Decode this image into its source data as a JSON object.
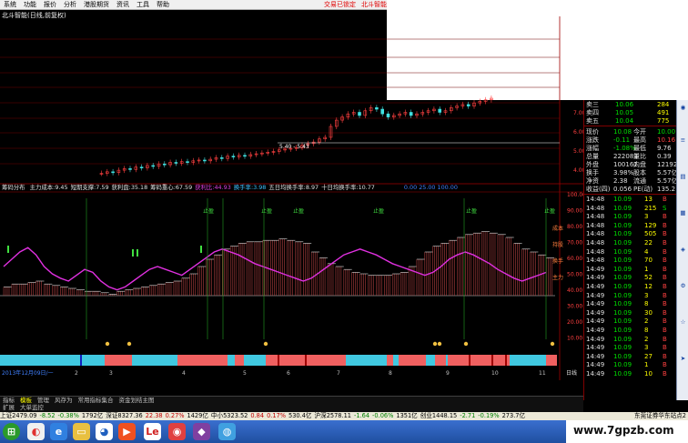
{
  "menu": [
    "系统",
    "功能",
    "报价",
    "分析",
    "港股期货",
    "资讯",
    "工具",
    "帮助"
  ],
  "trade_links": [
    "交易已锁定",
    "北斗智能"
  ],
  "chart_title": "北斗智能(日线,前复权)",
  "price_axis": [
    "7.00",
    "6.00",
    "5.00",
    "4.00"
  ],
  "range_label": "5.40 - 5.43",
  "indicator": {
    "name": "筹码分布",
    "items": [
      {
        "label": "主力成本:",
        "value": "9.45",
        "color": "#e0e0e0"
      },
      {
        "label": "短期支撑:",
        "value": "7.59",
        "color": "#e0e0e0"
      },
      {
        "label": "获利盘:",
        "value": "35.18",
        "color": "#e0e0e0"
      },
      {
        "label": "筹码重心:",
        "value": "67.59",
        "color": "#e0e0e0"
      },
      {
        "label": "获利比:",
        "value": "44.93",
        "color": "#e040e0"
      },
      {
        "label": "换手率:",
        "value": "3.98",
        "color": "#40c0ff"
      },
      {
        "label": "五日均换手率:",
        "value": "8.97",
        "color": "#e0e0e0"
      },
      {
        "label": "十日均换手率:",
        "value": "10.77",
        "color": "#e0e0e0"
      }
    ],
    "range": [
      "0.00",
      "25.00",
      "100.00"
    ]
  },
  "ind_axis": [
    "100.00",
    "90.00",
    "80.00",
    "70.00",
    "60.00",
    "50.00",
    "40.00",
    "30.00",
    "20.00",
    "10.00"
  ],
  "ind_side": [
    "成本",
    "持股",
    "换手",
    "主力"
  ],
  "markers": [
    "止盈",
    "止盈",
    "止盈",
    "止盈",
    "止盈",
    "止盈"
  ],
  "date_axis": [
    "2013年12月09日/一",
    "2",
    "3",
    "4",
    "5",
    "6",
    "7",
    "8",
    "9",
    "10",
    "11"
  ],
  "date_end": "日线",
  "quote": {
    "asks": [
      {
        "label": "卖三",
        "price": "10.06",
        "vol": "284"
      },
      {
        "label": "卖四",
        "price": "10.05",
        "vol": "491"
      },
      {
        "label": "卖五",
        "price": "10.04",
        "vol": "775"
      }
    ],
    "stats": [
      {
        "l": "现价",
        "v": "10.08",
        "l2": "今开",
        "v2": "10.00"
      },
      {
        "l": "涨跌",
        "v": "-0.11",
        "l2": "最高",
        "v2": "10.16"
      },
      {
        "l": "涨幅",
        "v": "-1.08%",
        "l2": "最低",
        "v2": "9.76"
      },
      {
        "l": "总量",
        "v": "222083",
        "l2": "量比",
        "v2": "0.39"
      },
      {
        "l": "外盘",
        "v": "100161",
        "l2": "内盘",
        "v2": "121922"
      },
      {
        "l": "换手",
        "v": "3.98%",
        "l2": "股本",
        "v2": "5.57亿"
      },
      {
        "l": "净资",
        "v": "2.38",
        "l2": "流通",
        "v2": "5.57亿"
      },
      {
        "l": "收益(四)",
        "v": "0.056",
        "l2": "PE(动)",
        "v2": "135.2"
      }
    ],
    "ticks": [
      {
        "t": "14:48",
        "p": "10.09",
        "v": "13",
        "s": "B"
      },
      {
        "t": "14:48",
        "p": "10.09",
        "v": "215",
        "s": "S"
      },
      {
        "t": "14:48",
        "p": "10.09",
        "v": "3",
        "s": "B"
      },
      {
        "t": "14:48",
        "p": "10.09",
        "v": "129",
        "s": "B"
      },
      {
        "t": "14:48",
        "p": "10.09",
        "v": "505",
        "s": "B"
      },
      {
        "t": "14:48",
        "p": "10.09",
        "v": "22",
        "s": "B"
      },
      {
        "t": "14:48",
        "p": "10.09",
        "v": "4",
        "s": "B"
      },
      {
        "t": "14:48",
        "p": "10.09",
        "v": "70",
        "s": "B"
      },
      {
        "t": "14:49",
        "p": "10.09",
        "v": "1",
        "s": "B"
      },
      {
        "t": "14:49",
        "p": "10.09",
        "v": "52",
        "s": "B"
      },
      {
        "t": "14:49",
        "p": "10.09",
        "v": "12",
        "s": "B"
      },
      {
        "t": "14:49",
        "p": "10.09",
        "v": "3",
        "s": "B"
      },
      {
        "t": "14:49",
        "p": "10.09",
        "v": "8",
        "s": "B"
      },
      {
        "t": "14:49",
        "p": "10.09",
        "v": "30",
        "s": "B"
      },
      {
        "t": "14:49",
        "p": "10.09",
        "v": "2",
        "s": "B"
      },
      {
        "t": "14:49",
        "p": "10.09",
        "v": "8",
        "s": "B"
      },
      {
        "t": "14:49",
        "p": "10.09",
        "v": "2",
        "s": "B"
      },
      {
        "t": "14:49",
        "p": "10.09",
        "v": "3",
        "s": "B"
      },
      {
        "t": "14:49",
        "p": "10.09",
        "v": "27",
        "s": "B"
      },
      {
        "t": "14:49",
        "p": "10.09",
        "v": "1",
        "s": "B"
      },
      {
        "t": "14:49",
        "p": "10.09",
        "v": "10",
        "s": "B"
      }
    ]
  },
  "bottom_tabs": [
    "指标",
    "模板",
    "管理",
    "风存为",
    "常用指标集合",
    "资金划结主图"
  ],
  "bottom_tabs2": [
    "扩展",
    "大单监控"
  ],
  "ticker": [
    {
      "t": "上证2479.09",
      "c": "#000"
    },
    {
      "t": "-8.52",
      "c": "#008000"
    },
    {
      "t": "-0.38%",
      "c": "#008000"
    },
    {
      "t": "1792亿",
      "c": "#000"
    },
    {
      "t": "深证8327.36",
      "c": "#000"
    },
    {
      "t": "22.38",
      "c": "#c00000"
    },
    {
      "t": "0.27%",
      "c": "#c00000"
    },
    {
      "t": "1429亿",
      "c": "#000"
    },
    {
      "t": "中小5323.52",
      "c": "#000"
    },
    {
      "t": "0.84",
      "c": "#c00000"
    },
    {
      "t": "0.17%",
      "c": "#c00000"
    },
    {
      "t": "530.4亿",
      "c": "#000"
    },
    {
      "t": "沪深2578.11",
      "c": "#000"
    },
    {
      "t": "-1.64",
      "c": "#008000"
    },
    {
      "t": "-0.06%",
      "c": "#008000"
    },
    {
      "t": "1351亿",
      "c": "#000"
    },
    {
      "t": "创业1448.15",
      "c": "#000"
    },
    {
      "t": "-2.71",
      "c": "#008000"
    },
    {
      "t": "-0.19%",
      "c": "#008000"
    },
    {
      "t": "273.7亿",
      "c": "#000"
    }
  ],
  "ticker_right": "东莞证券华东站点2",
  "watermark": "www.7gpzb.com",
  "candles": [
    3.2,
    3.3,
    3.25,
    3.4,
    3.5,
    3.45,
    3.6,
    3.55,
    3.7,
    3.65,
    3.8,
    3.75,
    3.9,
    3.85,
    3.95,
    3.9,
    4.0,
    4.05,
    4.0,
    4.1,
    4.2,
    4.15,
    4.3,
    4.25,
    4.35,
    4.3,
    4.4,
    4.45,
    4.5,
    4.55,
    4.6,
    4.7,
    4.75,
    4.8,
    4.85,
    5.0,
    5.1,
    5.2,
    5.4,
    5.5,
    6.2,
    6.6,
    6.8,
    7.0,
    7.1,
    6.9,
    7.2,
    7.4,
    7.3,
    7.0,
    6.8,
    6.9,
    7.0,
    7.1,
    6.9,
    7.0,
    7.1,
    7.2,
    7.3,
    7.1,
    7.2,
    7.4,
    7.5,
    7.6,
    7.5,
    7.7,
    7.8,
    7.9,
    8.0
  ],
  "ind_hist": [
    36,
    38,
    38,
    39,
    40,
    38,
    37,
    36,
    35,
    34,
    33,
    33,
    32,
    31,
    33,
    34,
    35,
    36,
    37,
    38,
    39,
    40,
    42,
    45,
    50,
    55,
    58,
    62,
    64,
    66,
    67,
    67,
    68,
    68,
    69,
    68,
    67,
    66,
    60,
    56,
    52,
    50,
    48,
    46,
    45,
    44,
    44,
    44,
    45,
    46,
    50,
    55,
    60,
    64,
    66,
    68,
    70,
    72,
    73,
    74,
    73,
    72,
    70,
    66,
    62,
    60,
    58,
    56
  ],
  "ind_line": [
    50,
    55,
    60,
    63,
    58,
    50,
    45,
    42,
    40,
    44,
    48,
    46,
    40,
    36,
    34,
    36,
    40,
    44,
    48,
    50,
    48,
    46,
    44,
    48,
    52,
    56,
    60,
    62,
    60,
    58,
    55,
    52,
    50,
    48,
    46,
    44,
    42,
    40,
    42,
    46,
    50,
    54,
    58,
    60,
    62,
    60,
    58,
    55,
    52,
    50,
    48,
    46,
    44,
    46,
    50,
    55,
    58,
    60,
    58,
    55,
    52,
    48,
    45,
    42,
    40,
    42,
    44,
    46
  ]
}
